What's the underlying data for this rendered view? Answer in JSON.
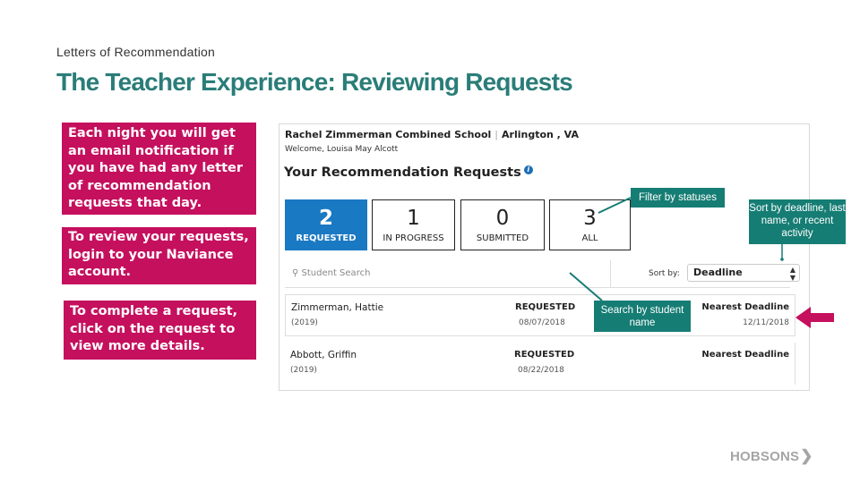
{
  "slide": {
    "subtitle": "Letters of Recommendation",
    "title": "The Teacher Experience: Reviewing Requests"
  },
  "callouts": [
    "Each night you will get an email notification if you have had any letter of recommendation requests that day.",
    "To review your requests, login to your Naviance account.",
    "To complete a request, click on the request to view more details."
  ],
  "app": {
    "school_name": "Rachel Zimmerman Combined School",
    "location": "Arlington , VA",
    "separator": "|",
    "welcome": "Welcome, Louisa May Alcott",
    "heading": "Your Recommendation Requests",
    "info_icon": "i",
    "status_tiles": [
      {
        "count": "2",
        "label": "REQUESTED",
        "active": true
      },
      {
        "count": "1",
        "label": "IN PROGRESS",
        "active": false
      },
      {
        "count": "0",
        "label": "SUBMITTED",
        "active": false
      },
      {
        "count": "3",
        "label": "ALL",
        "active": false
      }
    ],
    "search": {
      "icon": "⚲",
      "placeholder": "Student Search"
    },
    "sort": {
      "label": "Sort by:",
      "selected": "Deadline",
      "arrows": "▲▼"
    },
    "requests": [
      {
        "name": "Zimmerman, Hattie",
        "year": "(2019)",
        "status": "REQUESTED",
        "status_date": "08/07/2018",
        "deadline_label": "Nearest Deadline",
        "deadline_date": "12/11/2018"
      },
      {
        "name": "Abbott, Griffin",
        "year": "(2019)",
        "status": "REQUESTED",
        "status_date": "08/22/2018",
        "deadline_label": "Nearest Deadline",
        "deadline_date": ""
      }
    ]
  },
  "annotations": {
    "filter": "Filter by statuses",
    "sort": "Sort by deadline, last name, or recent activity",
    "search": "Search by student name"
  },
  "colors": {
    "title": "#2a7d78",
    "callout": "#c5105e",
    "annotation": "#167d74",
    "active_tile": "#1a79c3"
  },
  "logo": {
    "text": "HOBSONS",
    "chevron": "❯"
  }
}
